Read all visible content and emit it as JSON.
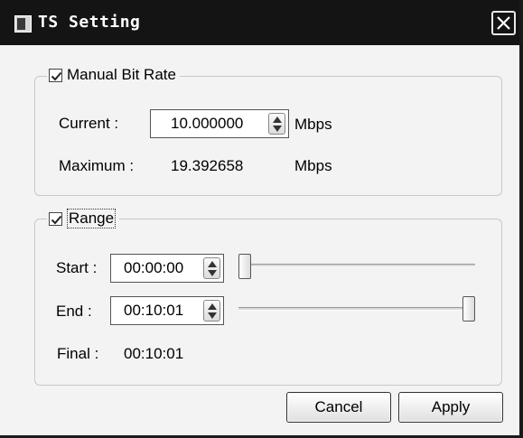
{
  "window": {
    "title": "TS Setting"
  },
  "manual_bit_rate": {
    "label": "Manual Bit Rate",
    "checked": true,
    "current_label": "Current :",
    "current_value": "10.000000",
    "current_unit": "Mbps",
    "maximum_label": "Maximum :",
    "maximum_value": "19.392658",
    "maximum_unit": "Mbps"
  },
  "range": {
    "label": "Range",
    "checked": true,
    "start_label": "Start :",
    "start_value": "00:00:00",
    "start_slider_fraction": 0.0,
    "end_label": "End :",
    "end_value": "00:10:01",
    "end_slider_fraction": 1.0,
    "final_label": "Final :",
    "final_value": "00:10:01"
  },
  "buttons": {
    "cancel": "Cancel",
    "apply": "Apply"
  },
  "icons": {
    "app": "app-icon",
    "close": "close-icon",
    "check": "checkmark-icon",
    "spin_up": "spin-up-icon",
    "spin_down": "spin-down-icon"
  }
}
